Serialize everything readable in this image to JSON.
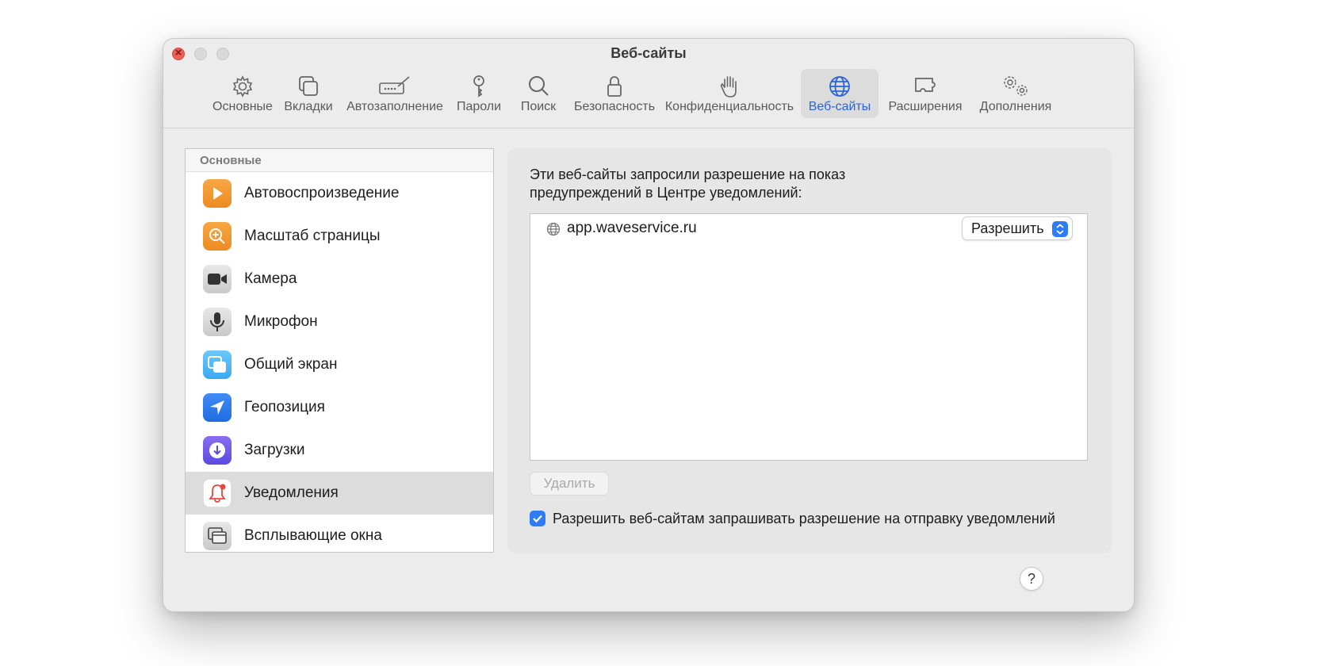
{
  "window": {
    "title": "Веб-сайты"
  },
  "toolbar": {
    "items": [
      {
        "label": "Основные",
        "icon": "gear-icon"
      },
      {
        "label": "Вкладки",
        "icon": "tabs-icon"
      },
      {
        "label": "Автозаполнение",
        "icon": "autofill-icon"
      },
      {
        "label": "Пароли",
        "icon": "key-icon"
      },
      {
        "label": "Поиск",
        "icon": "search-icon"
      },
      {
        "label": "Безопасность",
        "icon": "lock-icon"
      },
      {
        "label": "Конфиденциальность",
        "icon": "hand-icon"
      },
      {
        "label": "Веб-сайты",
        "icon": "globe-icon",
        "active": true
      },
      {
        "label": "Расширения",
        "icon": "puzzle-icon"
      },
      {
        "label": "Дополнения",
        "icon": "gears-icon"
      }
    ]
  },
  "sidebar": {
    "header": "Основные",
    "items": [
      {
        "label": "Автовоспроизведение",
        "icon": "play-icon"
      },
      {
        "label": "Масштаб страницы",
        "icon": "zoom-icon"
      },
      {
        "label": "Камера",
        "icon": "camera-icon"
      },
      {
        "label": "Микрофон",
        "icon": "microphone-icon"
      },
      {
        "label": "Общий экран",
        "icon": "screen-share-icon"
      },
      {
        "label": "Геопозиция",
        "icon": "location-icon"
      },
      {
        "label": "Загрузки",
        "icon": "download-icon"
      },
      {
        "label": "Уведомления",
        "icon": "bell-icon",
        "selected": true
      },
      {
        "label": "Всплывающие окна",
        "icon": "popup-window-icon"
      }
    ]
  },
  "main": {
    "description": "Эти веб-сайты запросили разрешение на показ предупреждений в Центре уведомлений:",
    "sites": [
      {
        "domain": "app.waveservice.ru",
        "permission": "Разрешить"
      }
    ],
    "remove_label": "Удалить",
    "allow_requests_label": "Разрешить веб-сайтам запрашивать разрешение на отправку уведомлений",
    "allow_requests_checked": true,
    "help_label": "?"
  },
  "colors": {
    "accent": "#2e7cf6",
    "active_tab": "#2a64d8"
  }
}
